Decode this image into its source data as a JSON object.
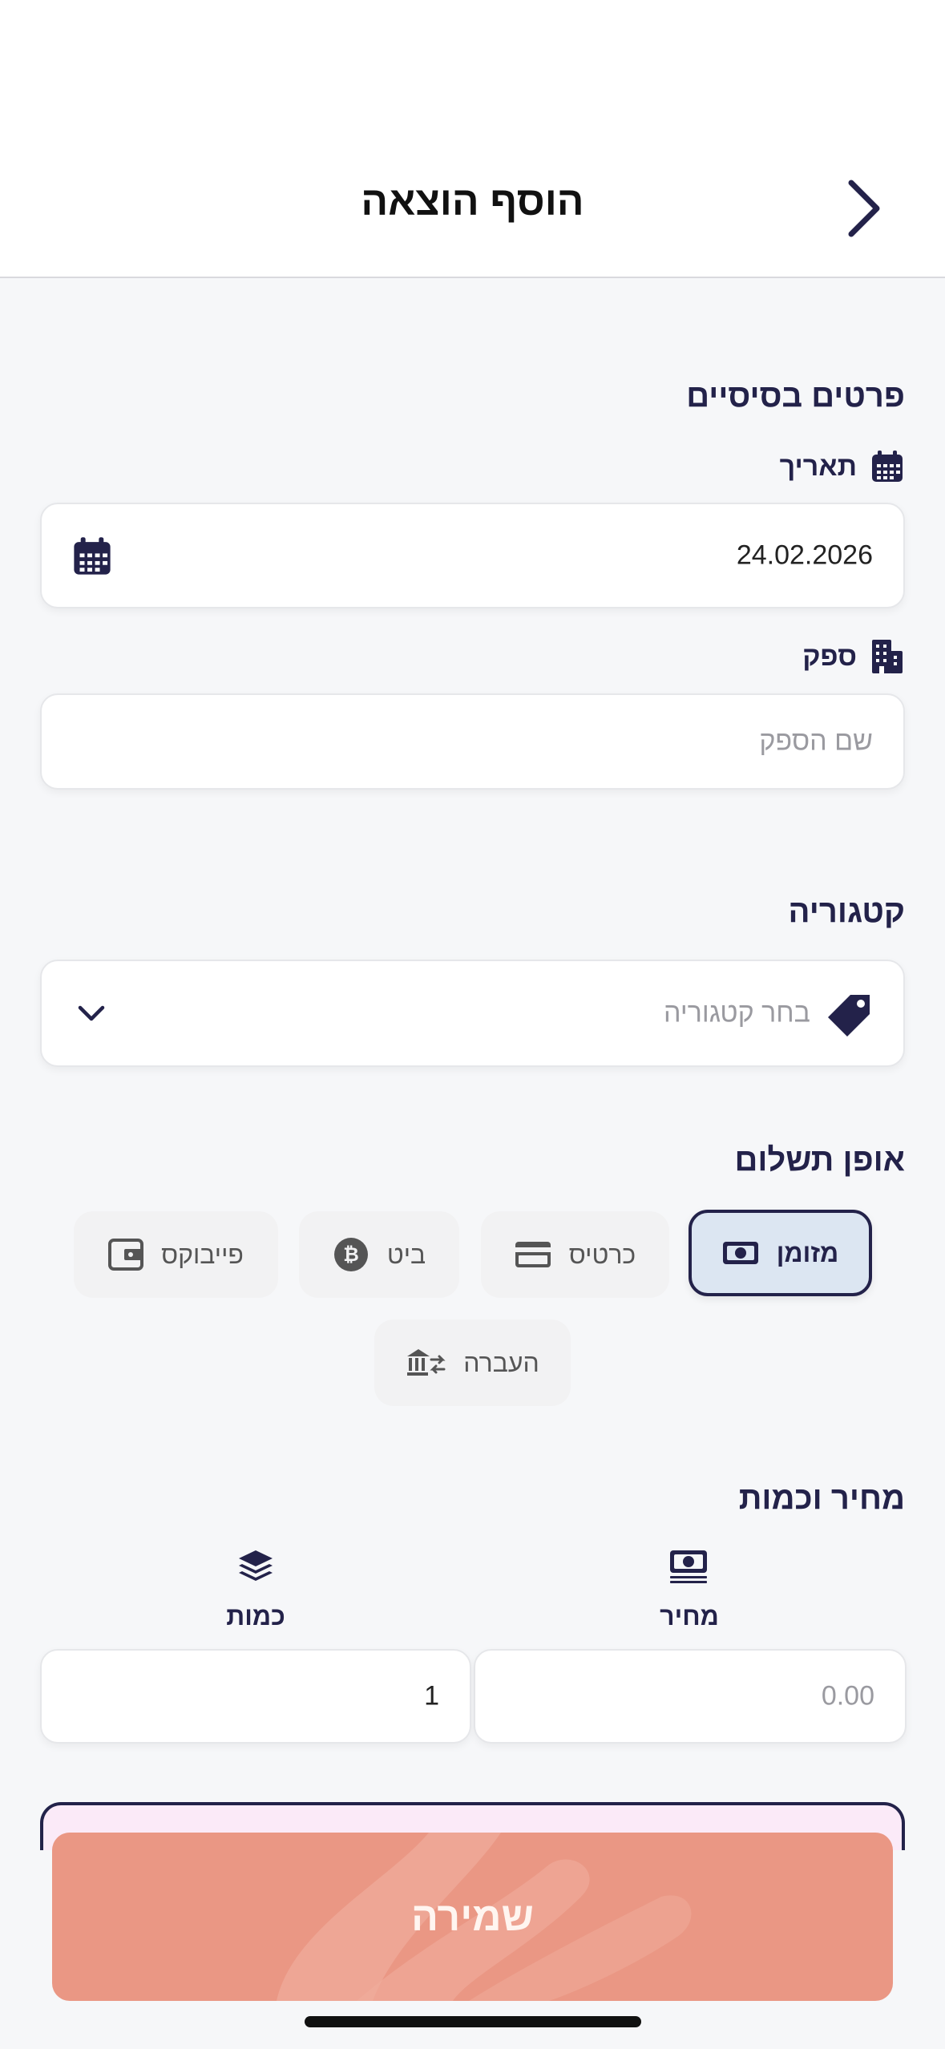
{
  "header": {
    "title": "הוסף הוצאה"
  },
  "basic": {
    "section_title": "פרטים בסיסיים",
    "date_label": "תאריך",
    "date_value": "24.02.2026",
    "supplier_label": "ספק",
    "supplier_placeholder": "שם הספק"
  },
  "category": {
    "section_title": "קטגוריה",
    "placeholder": "בחר קטגוריה"
  },
  "payment": {
    "section_title": "אופן תשלום",
    "options": [
      {
        "label": "מזומן",
        "icon": "cash-icon",
        "selected": true
      },
      {
        "label": "כרטיס",
        "icon": "credit-card-icon",
        "selected": false
      },
      {
        "label": "ביט",
        "icon": "bit-coin-icon",
        "selected": false
      },
      {
        "label": "פייבוקס",
        "icon": "wallet-icon",
        "selected": false
      },
      {
        "label": "העברה",
        "icon": "bank-transfer-icon",
        "selected": false
      }
    ]
  },
  "price_qty": {
    "section_title": "מחיר וכמות",
    "price_label": "מחיר",
    "price_placeholder": "0.00",
    "qty_label": "כמות",
    "qty_value": "1"
  },
  "footer": {
    "save_label": "שמירה"
  },
  "colors": {
    "primary": "#23224a",
    "selected_bg": "#dce6f2",
    "save_bg": "#ea9784",
    "page_bg": "#f6f7f9"
  }
}
